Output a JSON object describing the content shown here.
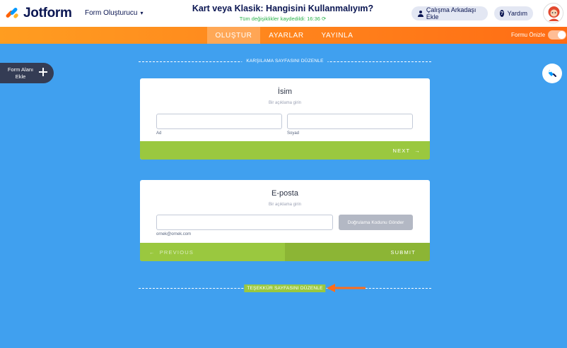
{
  "header": {
    "logo_text": "Jotform",
    "builder_dropdown": "Form Oluşturucu",
    "form_title": "Kart veya Klasik: Hangisini Kullanmalıyım?",
    "save_status": "Tüm değişiklikler kaydedildi: 16:36",
    "collab_button": "Çalışma Arkadaşı Ekle",
    "help_button": "Yardım"
  },
  "nav": {
    "tabs": [
      {
        "label": "OLUŞTUR",
        "active": true
      },
      {
        "label": "AYARLAR",
        "active": false
      },
      {
        "label": "YAYINLA",
        "active": false
      }
    ],
    "preview_label": "Formu Önizle"
  },
  "left_panel": {
    "add_field_label": "Form Alanı Ekle"
  },
  "page": {
    "welcome_label": "KARŞILAMA SAYFASINI DÜZENLE",
    "thankyou_label": "TEŞEKKÜR SAYFASINI DÜZENLE"
  },
  "card1": {
    "title": "İsim",
    "description": "Bir açıklama girin",
    "first_sublabel": "Ad",
    "last_sublabel": "Soyad",
    "next_label": "NEXT"
  },
  "card2": {
    "title": "E-posta",
    "description": "Bir açıklama girin",
    "email_sublabel": "ornek@ornek.com",
    "verify_button": "Doğrulama Kodunu Gönder",
    "prev_label": "PREVIOUS",
    "submit_label": "SUBMIT"
  },
  "colors": {
    "background": "#40a0ef",
    "accent_orange": "#ff7f17",
    "card_footer_green": "#9ac83f",
    "brand_navy": "#0a1551"
  }
}
